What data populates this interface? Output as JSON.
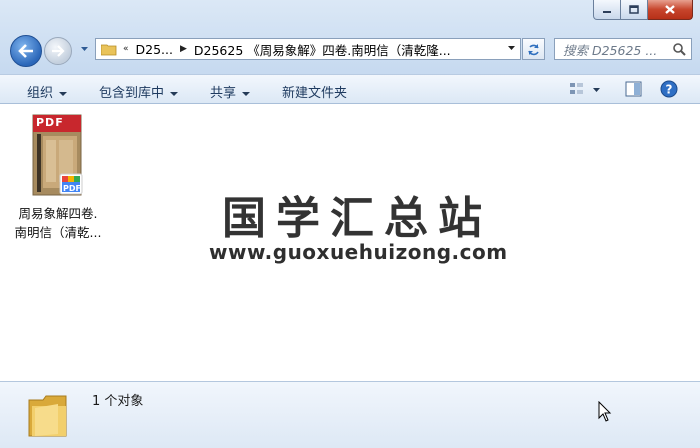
{
  "window": {
    "caption_buttons": {
      "minimize": "minimize-icon",
      "maximize": "maximize-icon",
      "close": "close-icon"
    }
  },
  "nav": {
    "breadcrumb": {
      "overflow": "«",
      "items": [
        "D25...",
        "D25625 《周易象解》四卷.南明信（清乾隆..."
      ]
    },
    "search": {
      "placeholder": "搜索 D25625 ..."
    }
  },
  "toolbar": {
    "organize": "组织",
    "include_library": "包含到库中",
    "share": "共享",
    "new_folder": "新建文件夹"
  },
  "files": [
    {
      "name_line1": "周易象解四卷.",
      "name_line2": "南明信（清乾...",
      "type_badge": "PDF",
      "app_badge": "PDF"
    }
  ],
  "watermark": {
    "title": "国学汇总站",
    "url": "www.guoxuehuizong.com"
  },
  "details": {
    "count": "1 个对象"
  },
  "colors": {
    "accent": "#2b67b9",
    "close": "#c7452c",
    "pdf_red": "#c8272d"
  }
}
